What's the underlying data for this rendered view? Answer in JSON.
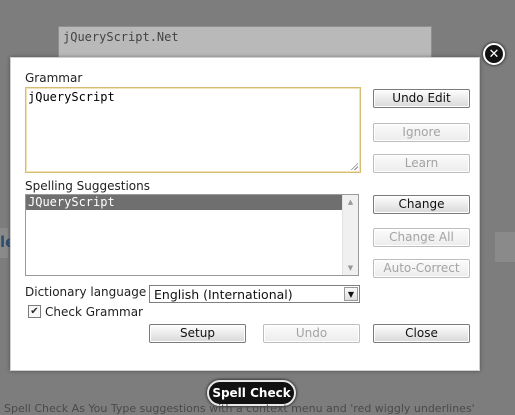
{
  "background": {
    "editor_text": "jQueryScript.Net",
    "side_left_text": "le",
    "spell_check_button": "Spell Check",
    "footer_text": "Spell Check As You Type suggestions with a context menu and 'red wiggly underlines'"
  },
  "dialog": {
    "grammar_label": "Grammar",
    "grammar_text": "jQueryScript",
    "spelling_label": "Spelling Suggestions",
    "suggestions": [
      "JQueryScript"
    ],
    "dictionary_label": "Dictionary language",
    "dictionary_value": "English (International)",
    "check_grammar_label": "Check Grammar",
    "check_grammar_checked": true,
    "buttons": {
      "undo_edit": "Undo Edit",
      "ignore": "Ignore",
      "learn": "Learn",
      "change": "Change",
      "change_all": "Change All",
      "auto_correct": "Auto-Correct",
      "setup": "Setup",
      "undo": "Undo",
      "close": "Close"
    },
    "close_glyph": "✕"
  },
  "icons": {
    "close": "close-icon",
    "dropdown": "chevron-down-icon",
    "scroll_up": "scroll-up-arrow",
    "scroll_down": "scroll-down-arrow",
    "resize": "resize-grip-icon"
  },
  "colors": {
    "overlay": "#7d7d7d",
    "selection": "#6f6f6f",
    "focus_border": "#d6bd73"
  }
}
